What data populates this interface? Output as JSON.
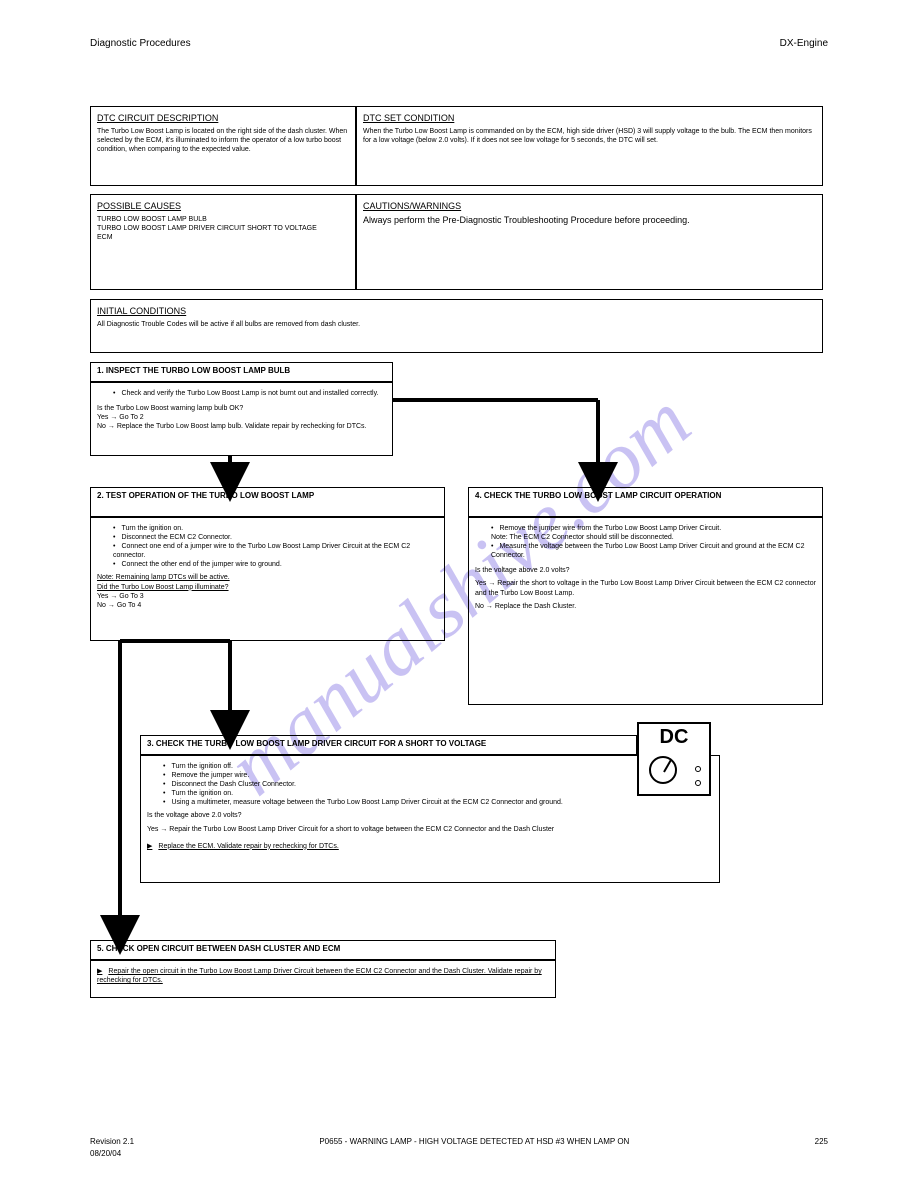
{
  "header": {
    "left": "Diagnostic Procedures",
    "right": "DX-Engine"
  },
  "watermark": "manualshive.com",
  "row1": {
    "leftTitle": "DTC CIRCUIT DESCRIPTION",
    "leftBody": "The Turbo Low Boost Lamp is located on the right side of the dash cluster. When selected by the ECM, it's illuminated to inform the operator of a low turbo boost condition, when comparing to the expected value.",
    "rightTitle": "DTC SET CONDITION",
    "rightBody": "When the Turbo Low Boost Lamp is commanded on by the ECM, high side driver (HSD) 3 will supply voltage to the bulb. The ECM then monitors for a low voltage (below 2.0 volts). If it does not see low voltage for 5 seconds, the DTC will set."
  },
  "row2": {
    "leftTitle": "POSSIBLE CAUSES",
    "leftItems": [
      "TURBO LOW BOOST LAMP BULB",
      "TURBO LOW BOOST LAMP DRIVER CIRCUIT SHORT TO VOLTAGE",
      "ECM"
    ],
    "rightTitle": "CAUTIONS/WARNINGS",
    "rightBody": "Always perform the Pre-Diagnostic Troubleshooting Procedure before proceeding."
  },
  "initCond": {
    "title": "INITIAL CONDITIONS",
    "body": "All Diagnostic Trouble Codes will be active if all bulbs are removed from dash cluster."
  },
  "step1": {
    "title": "1. INSPECT THE TURBO LOW BOOST LAMP BULB",
    "item": "Check and verify the Turbo Low Boost Lamp is not burnt out and installed correctly.",
    "question": "Is the Turbo Low Boost warning lamp bulb OK?",
    "yes": "Yes → Go To 2",
    "no": "No → Replace the Turbo Low Boost lamp bulb. Validate repair by rechecking for DTCs."
  },
  "step2": {
    "title": "2. TEST OPERATION OF THE TURBO LOW BOOST LAMP",
    "items": [
      "Turn the ignition on.",
      "Disconnect the ECM C2 Connector.",
      "Connect one end of a jumper wire to the Turbo Low Boost Lamp Driver Circuit at the ECM C2 connector.",
      "Connect the other end of the jumper wire to ground."
    ],
    "note": "Note: Remaining lamp DTCs will be active.",
    "question": "Did the Turbo Low Boost Lamp illuminate?",
    "yes": "Yes → Go To 3",
    "no": "No → Go To 4"
  },
  "step4": {
    "title": "4. CHECK THE TURBO LOW BOOST LAMP CIRCUIT OPERATION",
    "items": [
      "Remove the jumper wire from the Turbo Low Boost Lamp Driver Circuit.",
      "Note: The ECM C2 Connector should still be disconnected.",
      "Measure the voltage between the Turbo Low Boost Lamp Driver Circuit and ground at the ECM C2 Connector."
    ],
    "question": "Is the voltage above 2.0 volts?",
    "yes": "Yes → Repair the short to voltage in the Turbo Low Boost Lamp Driver Circuit between the ECM C2 connector and the Turbo Low Boost Lamp.",
    "no": "No → Replace the Dash Cluster."
  },
  "step3": {
    "title": "3. CHECK THE TURBO LOW BOOST LAMP DRIVER CIRCUIT FOR A SHORT TO VOLTAGE",
    "items": [
      "Turn the ignition off.",
      "Remove the jumper wire.",
      "Disconnect the Dash Cluster Connector.",
      "Turn the ignition on.",
      "Using a multimeter, measure voltage between the Turbo Low Boost Lamp Driver Circuit at the ECM C2 Connector and ground."
    ],
    "question": "Is the voltage above 2.0 volts?",
    "yes": "Yes → Repair the Turbo Low Boost Lamp Driver Circuit for a short to voltage between the ECM C2 Connector and the Dash Cluster",
    "result": "Replace the ECM. Validate repair by rechecking for DTCs."
  },
  "step5": {
    "title": "5. CHECK OPEN CIRCUIT BETWEEN DASH CLUSTER AND ECM",
    "result": "Repair the open circuit in the Turbo Low Boost Lamp Driver Circuit between the ECM C2 Connector and the Dash Cluster. Validate repair by rechecking for DTCs."
  },
  "dcIcon": {
    "label": "DC"
  },
  "footer": {
    "rev": "Revision 2.1",
    "title": "P0655 - WARNING LAMP - HIGH VOLTAGE DETECTED AT HSD #3 WHEN LAMP ON",
    "date": "08/20/04",
    "page": "225"
  }
}
